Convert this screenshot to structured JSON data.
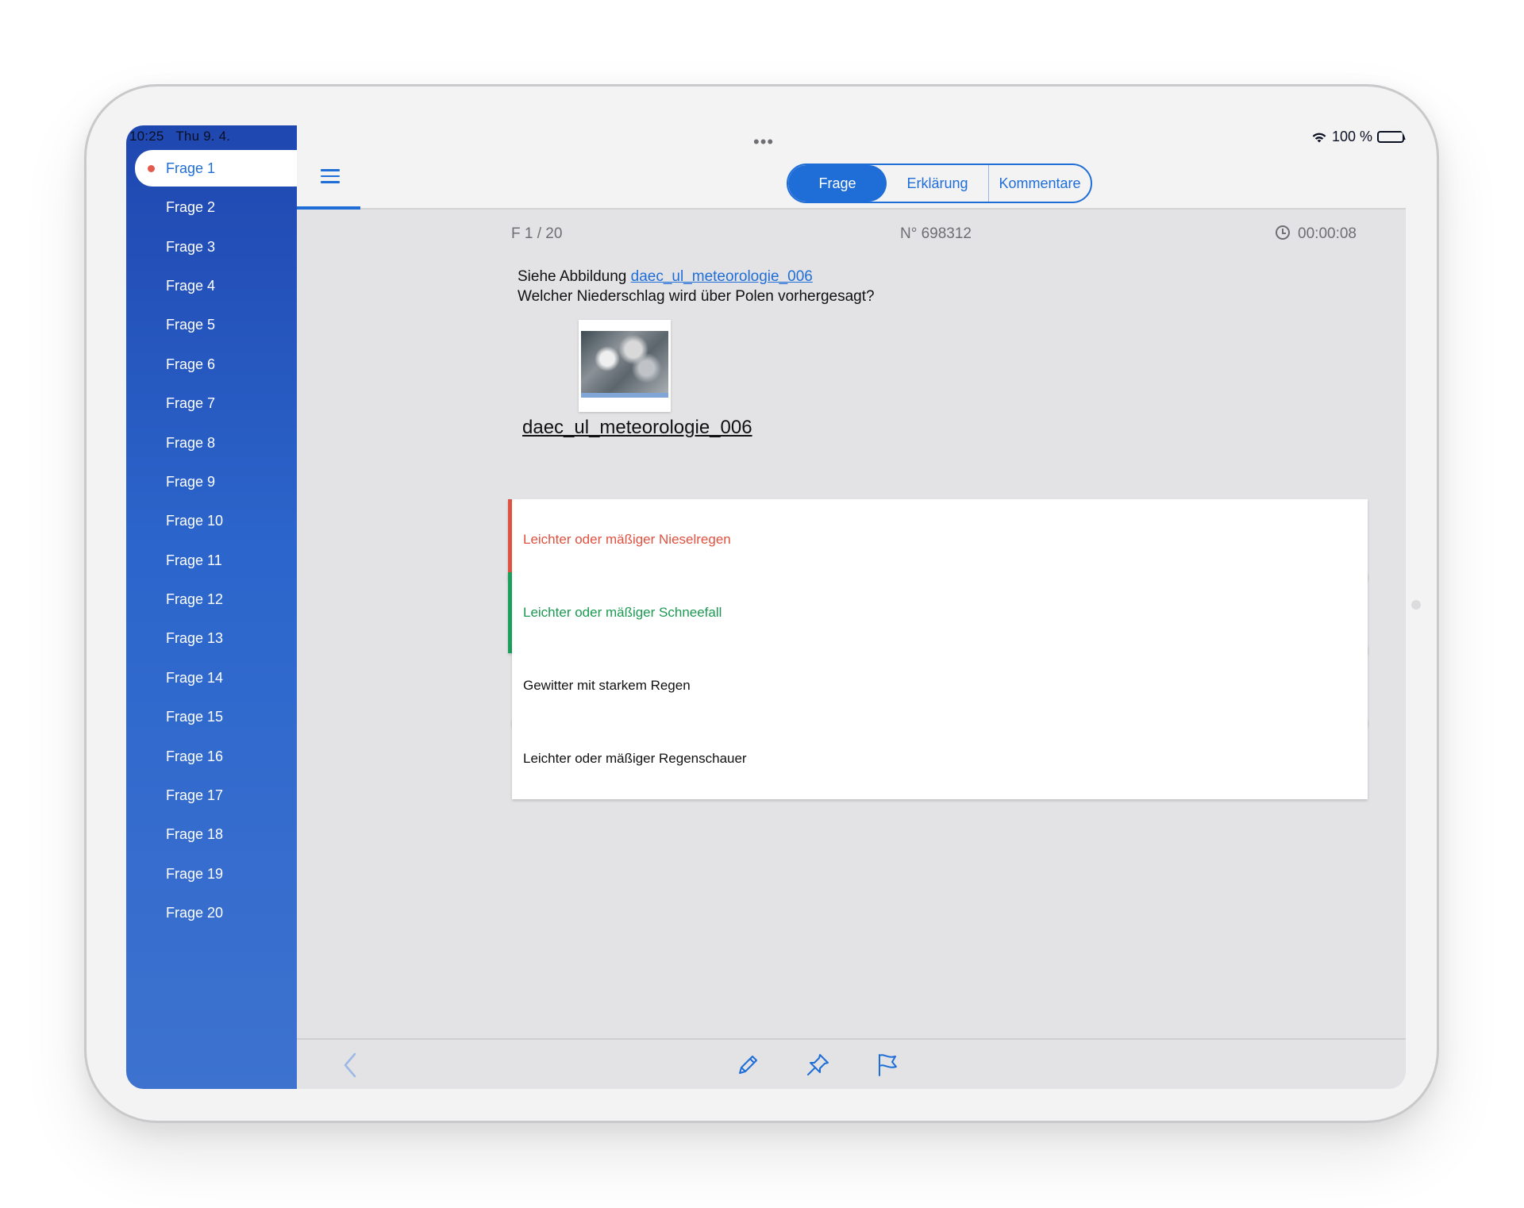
{
  "status": {
    "time": "10:25",
    "date": "Thu 9. 4.",
    "battery": "100 %",
    "multitask_dots": "•••"
  },
  "sidebar": {
    "items": [
      {
        "label": "Frage 1"
      },
      {
        "label": "Frage 2"
      },
      {
        "label": "Frage 3"
      },
      {
        "label": "Frage 4"
      },
      {
        "label": "Frage 5"
      },
      {
        "label": "Frage 6"
      },
      {
        "label": "Frage 7"
      },
      {
        "label": "Frage 8"
      },
      {
        "label": "Frage 9"
      },
      {
        "label": "Frage 10"
      },
      {
        "label": "Frage 11"
      },
      {
        "label": "Frage 12"
      },
      {
        "label": "Frage 13"
      },
      {
        "label": "Frage 14"
      },
      {
        "label": "Frage 15"
      },
      {
        "label": "Frage 16"
      },
      {
        "label": "Frage 17"
      },
      {
        "label": "Frage 18"
      },
      {
        "label": "Frage 19"
      },
      {
        "label": "Frage 20"
      }
    ],
    "active_index": 0
  },
  "tabs": {
    "items": [
      "Frage",
      "Erklärung",
      "Kommentare"
    ],
    "active": "Frage"
  },
  "meta": {
    "progress": "F  1 / 20",
    "number": "N° 698312",
    "timer": "00:00:08"
  },
  "question": {
    "prefix": "Siehe Abbildung",
    "link": "daec_ul_meteorologie_006",
    "text": "Welcher Niederschlag wird über Polen vorhergesagt?",
    "figure_caption": "daec_ul_meteorologie_006"
  },
  "answers": [
    {
      "text": "Leichter oder mäßiger Nieselregen",
      "state": "wrong"
    },
    {
      "text": "Leichter oder mäßiger Schneefall",
      "state": "correct"
    },
    {
      "text": "Gewitter mit starkem Regen",
      "state": "neutral"
    },
    {
      "text": "Leichter oder mäßiger Regenschauer",
      "state": "neutral"
    }
  ],
  "colors": {
    "accent": "#1f6ed8",
    "wrong": "#e0513f",
    "correct": "#1a9a52",
    "sidebar_top": "#1f47b0",
    "sidebar_bottom": "#3d72cf"
  },
  "toolbar": {
    "icons": [
      "back-chevron-icon",
      "pencil-icon",
      "pin-icon",
      "flag-icon"
    ]
  }
}
